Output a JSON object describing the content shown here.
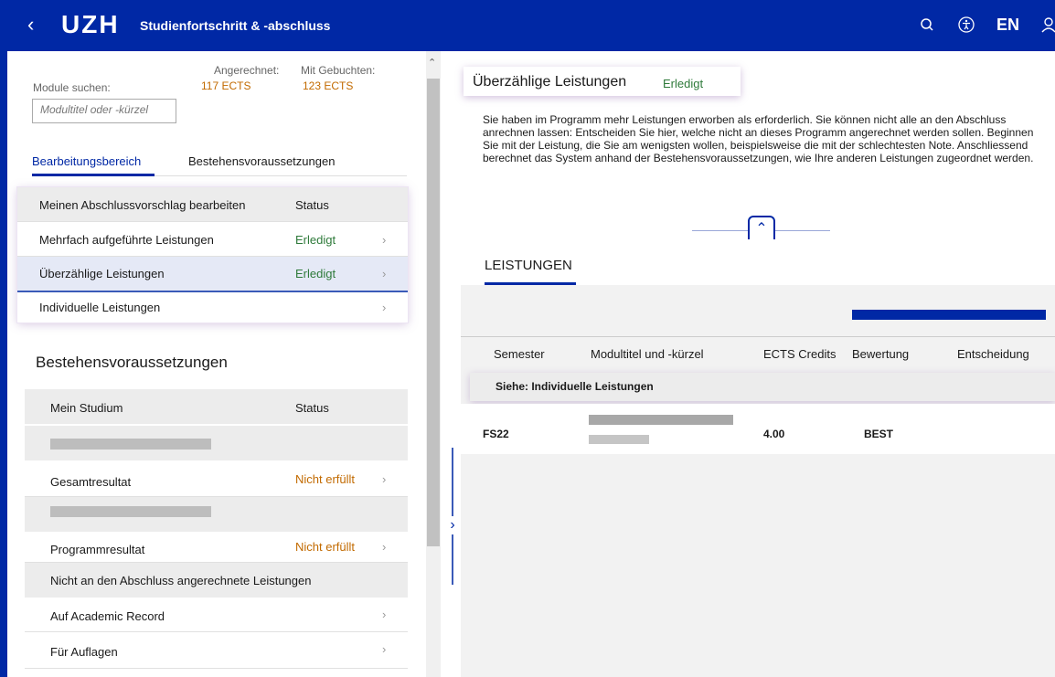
{
  "header": {
    "back_icon": "chevron-left-icon",
    "logo": "UZH",
    "title": "Studienfortschritt & -abschluss",
    "language": "EN"
  },
  "left": {
    "search_label": "Module suchen:",
    "credited_label": "Angerechnet:",
    "credited_value": "117 ECTS",
    "booked_label": "Mit Gebuchten:",
    "booked_value": "123 ECTS",
    "search_placeholder": "Modultitel oder -kürzel",
    "tabs": [
      "Bearbeitungsbereich",
      "Bestehensvoraussetzungen"
    ],
    "edit_header": {
      "title": "Meinen Abschlussvorschlag bearbeiten",
      "status": "Status"
    },
    "edit_items": [
      {
        "label": "Mehrfach aufgeführte Leistungen",
        "status": "Erledigt"
      },
      {
        "label": "Überzählige Leistungen",
        "status": "Erledigt"
      },
      {
        "label": "Individuelle Leistungen",
        "status": ""
      }
    ],
    "req_title": "Bestehensvoraussetzungen",
    "req_header": {
      "title": "Mein Studium",
      "status": "Status"
    },
    "req_items": [
      {
        "label": "Gesamtresultat",
        "status": "Nicht erfüllt"
      },
      {
        "label": "Programmresultat",
        "status": "Nicht erfüllt"
      }
    ],
    "not_credited_header": "Nicht an den Abschluss angerechnete Leistungen",
    "not_credited_items": [
      "Auf Academic Record",
      "Für Auflagen"
    ]
  },
  "right": {
    "card_title": "Überzählige Leistungen",
    "card_status": "Erledigt",
    "info_text": "Sie haben im Programm mehr Leistungen erworben als erforderlich. Sie können nicht alle an den Abschluss anrechnen lassen: Entscheiden Sie hier, welche nicht an dieses Programm angerechnet werden sollen. Beginnen Sie mit der Leistung, die Sie am wenigsten wollen, beispielsweise die mit der schlechtesten Note. Anschliessend berechnet das System anhand der Bestehensvoraussetzungen, wie Ihre anderen Leistungen zugeordnet werden.",
    "section_tab": "LEISTUNGEN",
    "columns": [
      "Semester",
      "Modultitel und -kürzel",
      "ECTS Credits",
      "Bewertung",
      "Entscheidung"
    ],
    "group_label": "Siehe: Individuelle Leistungen",
    "rows": [
      {
        "semester": "FS22",
        "ects": "4.00",
        "rating": "BEST"
      }
    ]
  }
}
